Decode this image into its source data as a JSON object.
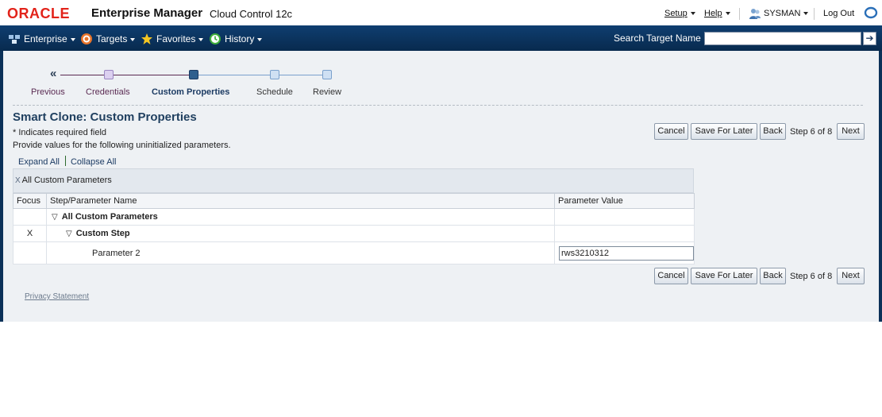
{
  "branding": {
    "oracle": "ORACLE",
    "product": "Enterprise Manager",
    "edition": "Cloud Control 12c"
  },
  "toplinks": {
    "setup": "Setup",
    "help": "Help",
    "user": "SYSMAN",
    "logout": "Log Out"
  },
  "nav": {
    "enterprise": "Enterprise",
    "targets": "Targets",
    "favorites": "Favorites",
    "history": "History",
    "search_label": "Search Target Name",
    "search_value": ""
  },
  "train": {
    "previous": "Previous",
    "steps": [
      "Credentials",
      "Custom Properties",
      "Schedule",
      "Review"
    ],
    "current_index": 1
  },
  "page": {
    "title": "Smart Clone: Custom Properties",
    "required_note": "* Indicates required field",
    "instructions": "Provide values for the following uninitialized parameters.",
    "expand_all": "Expand All",
    "collapse_all": "Collapse All",
    "step_text": "Step 6 of 8",
    "privacy": "Privacy Statement"
  },
  "buttons": {
    "cancel": "Cancel",
    "save_for_later": "Save For Later",
    "back": "Back",
    "next": "Next"
  },
  "table": {
    "breadcrumb_x": "X",
    "breadcrumb": "All Custom Parameters",
    "columns": [
      "Focus",
      "Step/Parameter Name",
      "Parameter Value"
    ],
    "rows": [
      {
        "focus": "",
        "name": "All Custom Parameters",
        "value": ""
      },
      {
        "focus": "X",
        "name": "Custom Step",
        "value": ""
      },
      {
        "focus": "",
        "name": "Parameter 2",
        "value": "rws3210312"
      }
    ]
  },
  "colors": {
    "oracle_red": "#e2231a",
    "nav_blue": "#0f3e70",
    "title_blue": "#1f3f5f",
    "train_visited": "#5a2a52",
    "train_current": "#1c3b63",
    "train_future": "#7aa0cc"
  },
  "icons": {
    "user": "user-icon",
    "logout": "logout-globe-icon",
    "enterprise": "enterprise-icon",
    "targets": "targets-icon",
    "favorites": "star-icon",
    "history": "history-icon",
    "search_go": "arrow-right-icon",
    "disclosure": "triangle-down-icon",
    "train_prev": "double-left-arrow-icon"
  }
}
